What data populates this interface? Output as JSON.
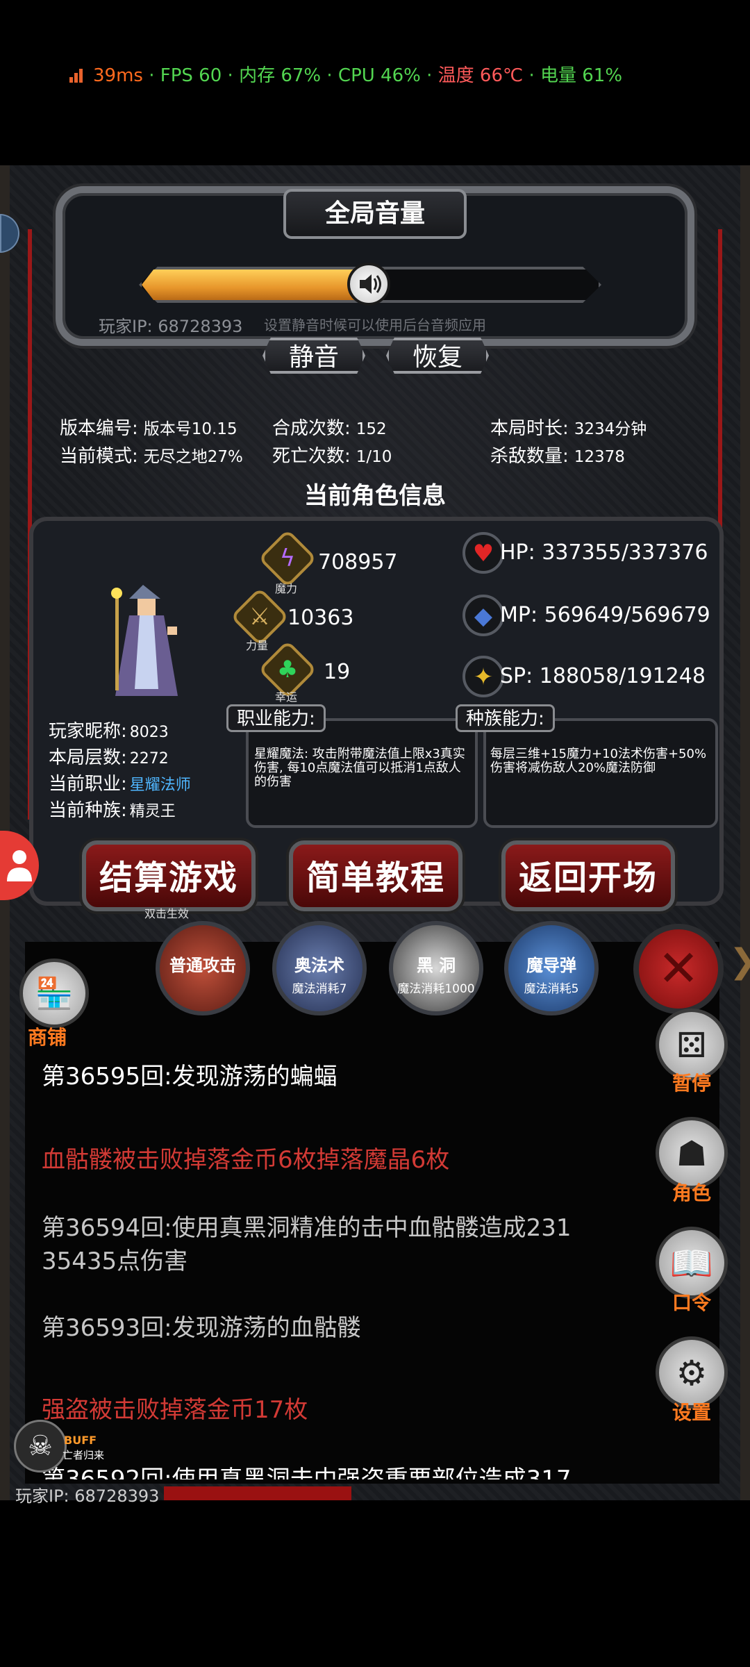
{
  "status_bar": {
    "ping": "39ms",
    "fps": "FPS 60",
    "memory": "内存 67%",
    "cpu": "CPU 46%",
    "temperature": "温度 66℃",
    "battery": "电量 61%",
    "sep": " · ",
    "colors": {
      "ping": "#ff6a1e",
      "ok": "#53d651",
      "warn": "#ff5a5a"
    }
  },
  "volume": {
    "title": "全局音量",
    "level_percent": 52,
    "player_ip": "玩家IP:  68728393",
    "hint": "设置静音时候可以使用后台音频应用",
    "mute_label": "静音",
    "restore_label": "恢复"
  },
  "stats": {
    "version_label": "版本编号:",
    "version_value": "版本号10.15",
    "mode_label": "当前模式:",
    "mode_value": "无尽之地27%",
    "craft_label": "合成次数:",
    "craft_value": "152",
    "death_label": "死亡次数:",
    "death_value": "1/10",
    "time_label": "本局时长:",
    "time_value": "3234分钟",
    "kills_label": "杀敌数量:",
    "kills_value": "12378"
  },
  "character": {
    "section_title": "当前角色信息",
    "magic_value": "708957",
    "magic_label": "魔力",
    "strength_value": "10363",
    "strength_label": "力量",
    "luck_value": "19",
    "luck_label": "幸运",
    "hp": "HP:  337355/337376",
    "mp": "MP:  569649/569679",
    "sp": "SP:  188058/191248",
    "nickname_label": "玩家昵称:",
    "nickname_value": "8023",
    "floor_label": "本局层数:",
    "floor_value": "2272",
    "job_label": "当前职业:",
    "job_value": "星耀法师",
    "race_label": "当前种族:",
    "race_value": "精灵王",
    "job_ability_title": "职业能力:",
    "job_ability_text": "星耀魔法: 攻击附带魔法值上限x3真实伤害, 每10点魔法值可以抵消1点敌人的伤害",
    "race_ability_title": "种族能力:",
    "race_ability_text": "每层三维+15魔力+10法术伤害+50%伤害将减伤敌人20%魔法防御",
    "job_color": "#4fb6ff"
  },
  "buttons": {
    "settle": "结算游戏",
    "settle_note": "双击生效",
    "tutorial": "简单教程",
    "back": "返回开场"
  },
  "skills": [
    {
      "name": "普通攻击",
      "cost": ""
    },
    {
      "name": "奥法术",
      "cost": "魔法消耗7"
    },
    {
      "name": "黑 洞",
      "cost": "魔法消耗1000"
    },
    {
      "name": "魔导弹",
      "cost": "魔法消耗5"
    }
  ],
  "shop": {
    "label": "商铺",
    "icon": "shop-icon"
  },
  "side": {
    "pause": "暂停",
    "role": "角色",
    "code": "口令",
    "settings": "设置"
  },
  "log": [
    {
      "text": "第36595回:发现游荡的蝙蝠",
      "tone": "white"
    },
    {
      "text": "血骷髅被击败掉落金币6枚掉落魔晶6枚",
      "tone": "red"
    },
    {
      "text": "第36594回:使用真黑洞精准的击中血骷髅造成231 35435点伤害",
      "tone": "gray"
    },
    {
      "text": "第36593回:发现游荡的血骷髅",
      "tone": "gray"
    },
    {
      "text": "强盗被击败掉落金币17枚",
      "tone": "red"
    },
    {
      "text": "第36592回:使用真黑洞击中强盗重要部位造成317",
      "tone": "white"
    }
  ],
  "buff": {
    "label": "BUFF",
    "sub": "亡者归来"
  },
  "bottom_ip": "玩家IP:  68728393"
}
